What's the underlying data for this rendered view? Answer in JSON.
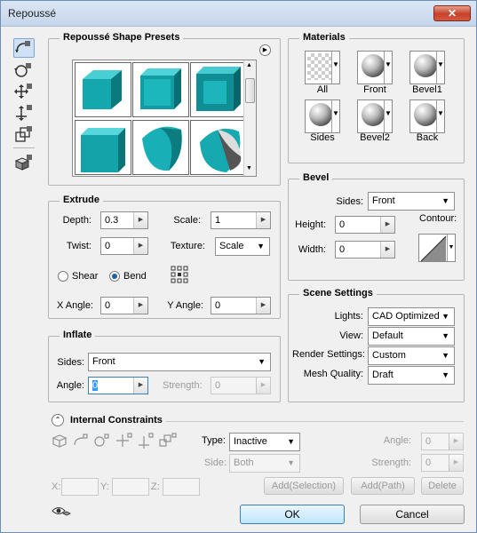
{
  "window": {
    "title": "Repoussé",
    "close_glyph": "✕"
  },
  "presets": {
    "title": "Repoussé Shape Presets",
    "menu_glyph": "▶"
  },
  "materials": {
    "title": "Materials",
    "items": [
      {
        "label": "All"
      },
      {
        "label": "Front"
      },
      {
        "label": "Bevel1"
      },
      {
        "label": "Sides"
      },
      {
        "label": "Bevel2"
      },
      {
        "label": "Back"
      }
    ]
  },
  "extrude": {
    "title": "Extrude",
    "depth_label": "Depth:",
    "depth_value": "0.3",
    "scale_label": "Scale:",
    "scale_value": "1",
    "twist_label": "Twist:",
    "twist_value": "0",
    "texture_label": "Texture:",
    "texture_value": "Scale",
    "shear_label": "Shear",
    "bend_label": "Bend",
    "xangle_label": "X Angle:",
    "xangle_value": "0",
    "yangle_label": "Y Angle:",
    "yangle_value": "0"
  },
  "bevel": {
    "title": "Bevel",
    "sides_label": "Sides:",
    "sides_value": "Front",
    "height_label": "Height:",
    "height_value": "0",
    "width_label": "Width:",
    "width_value": "0",
    "contour_label": "Contour:"
  },
  "scene": {
    "title": "Scene Settings",
    "lights_label": "Lights:",
    "lights_value": "CAD Optimized",
    "view_label": "View:",
    "view_value": "Default",
    "render_label": "Render Settings:",
    "render_value": "Custom",
    "mesh_label": "Mesh Quality:",
    "mesh_value": "Draft"
  },
  "inflate": {
    "title": "Inflate",
    "sides_label": "Sides:",
    "sides_value": "Front",
    "angle_label": "Angle:",
    "angle_value": "0",
    "strength_label": "Strength:",
    "strength_value": "0"
  },
  "constraints": {
    "title": "Internal Constraints",
    "type_label": "Type:",
    "type_value": "Inactive",
    "side_label": "Side:",
    "side_value": "Both",
    "angle_label": "Angle:",
    "angle_value": "0",
    "strength_label": "Strength:",
    "strength_value": "0",
    "x_label": "X:",
    "y_label": "Y:",
    "z_label": "Z:",
    "add_selection": "Add(Selection)",
    "add_path": "Add(Path)",
    "delete": "Delete"
  },
  "footer": {
    "ok": "OK",
    "cancel": "Cancel"
  },
  "colors": {
    "accent": "#1ab2b8",
    "ok_border": "#3c7fb1"
  }
}
